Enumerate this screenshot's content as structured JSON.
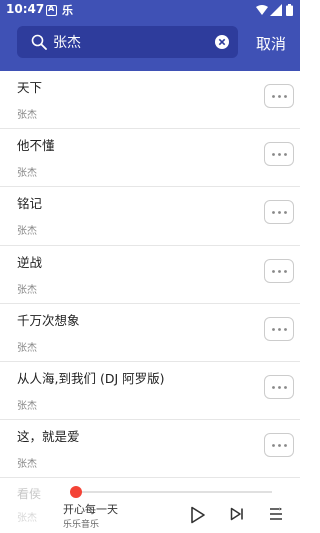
{
  "status_bar": {
    "time": "10:47",
    "app_glyph": "乐"
  },
  "search": {
    "value": "张杰",
    "cancel_label": "取消"
  },
  "songs": [
    {
      "title": "天下",
      "artist": "张杰"
    },
    {
      "title": "他不懂",
      "artist": "张杰"
    },
    {
      "title": "铭记",
      "artist": "张杰"
    },
    {
      "title": "逆战",
      "artist": "张杰"
    },
    {
      "title": "千万次想象",
      "artist": "张杰"
    },
    {
      "title": "从人海,到我们 (DJ 阿罗版)",
      "artist": "张杰"
    },
    {
      "title": "这，就是爱",
      "artist": "张杰"
    }
  ],
  "partial_song": {
    "title": "看侯",
    "artist": "张杰"
  },
  "player": {
    "track_title": "开心每一天",
    "app_name": "乐乐音乐",
    "progress": 0
  },
  "colors": {
    "header": "#3F51B5",
    "search_box": "#2E3C9C",
    "accent": "#F44336"
  },
  "icons": [
    "search-icon",
    "clear-icon",
    "more-icon",
    "play-icon",
    "next-icon",
    "playlist-icon",
    "wifi-icon",
    "signal-icon",
    "battery-icon"
  ]
}
